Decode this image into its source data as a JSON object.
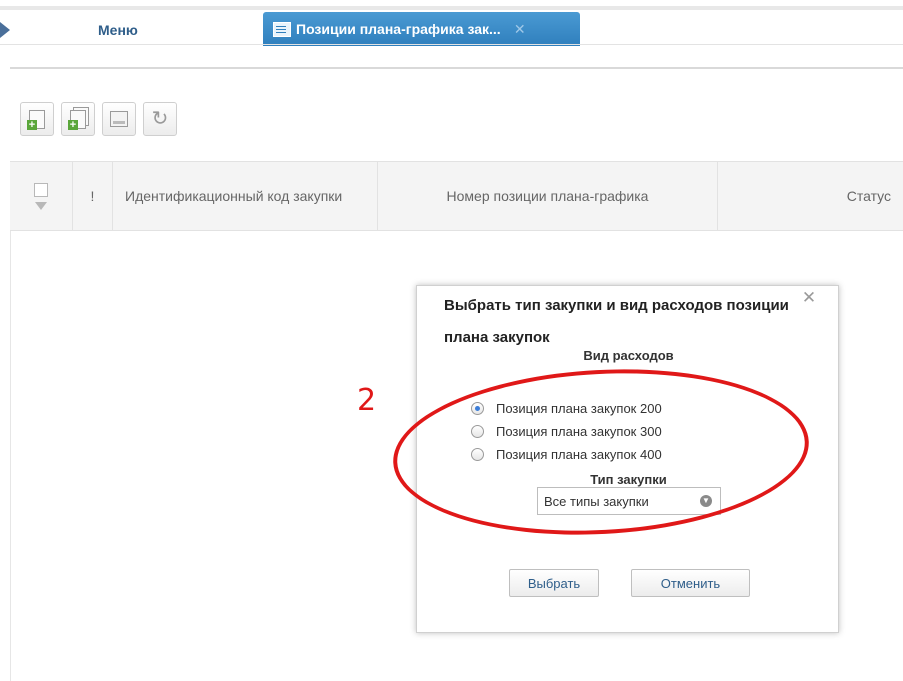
{
  "header": {
    "menu_label": "Меню",
    "active_tab_label": "Позиции плана-графика зак...",
    "tab_close_glyph": "✕"
  },
  "toolbar": {
    "buttons": [
      {
        "name": "add-document",
        "icon": "add-document-icon"
      },
      {
        "name": "copy-document",
        "icon": "copy-document-icon"
      },
      {
        "name": "print",
        "icon": "print-icon"
      },
      {
        "name": "refresh",
        "icon": "refresh-icon",
        "glyph": "↻"
      }
    ]
  },
  "table": {
    "columns": [
      {
        "label": "!"
      },
      {
        "label": "Идентификационный код закупки"
      },
      {
        "label": "Номер позиции плана-графика"
      },
      {
        "label": "Статус"
      }
    ]
  },
  "modal": {
    "title": "Выбрать тип закупки и вид расходов позиции плана закупок",
    "close_glyph": "✕",
    "expense_section_label": "Вид расходов",
    "options": [
      {
        "label": "Позиция плана закупок 200",
        "checked": true
      },
      {
        "label": "Позиция плана закупок 300",
        "checked": false
      },
      {
        "label": "Позиция плана закупок 400",
        "checked": false
      }
    ],
    "procurement_type_label": "Тип закупки",
    "procurement_type_value": "Все типы закупки",
    "choose_button": "Выбрать",
    "cancel_button": "Отменить"
  },
  "annotation": {
    "number": "2",
    "color": "#e01818"
  },
  "colors": {
    "accent_tab": "#2f7fbd",
    "link_text": "#2f5e8a"
  }
}
